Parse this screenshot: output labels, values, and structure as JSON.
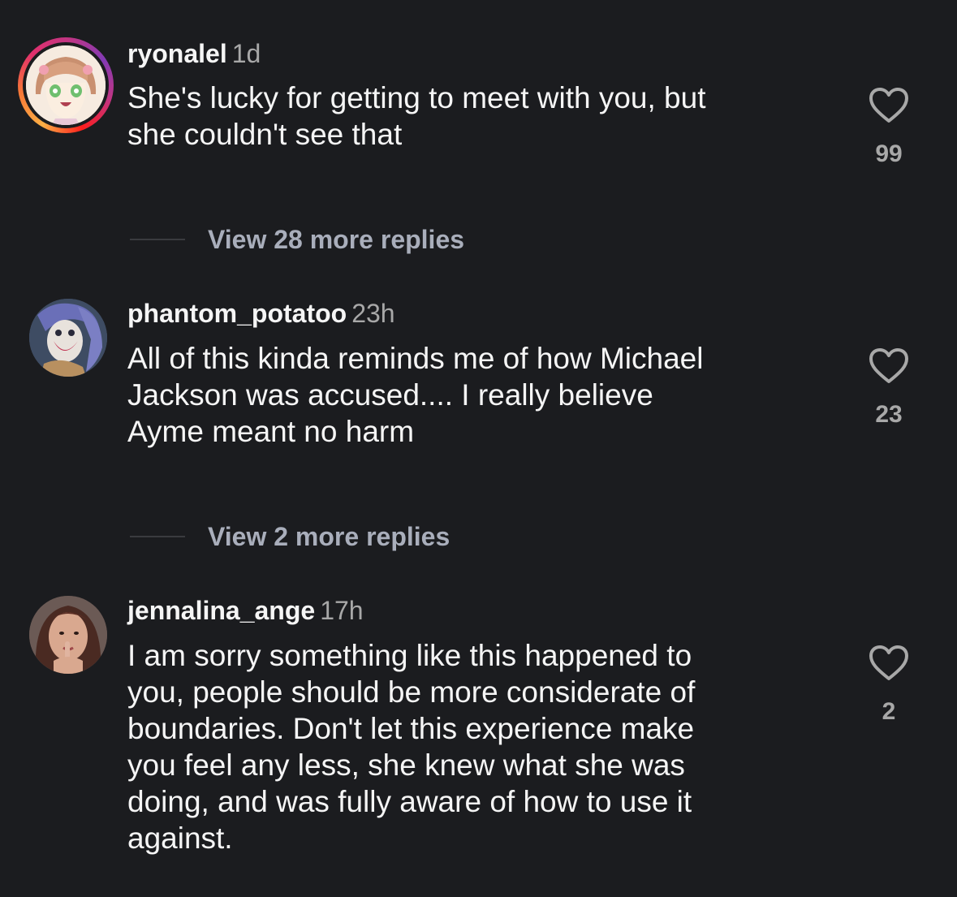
{
  "comments": [
    {
      "username": "ryonalel",
      "time": "1d",
      "text_lines": [
        "She's lucky for getting to meet with you, but",
        "she couldn't see that"
      ],
      "likes": "99",
      "has_story_ring": true,
      "avatar": "anime-girl-avatar"
    },
    {
      "username": "phantom_potatoo",
      "time": "23h",
      "text_lines": [
        "All of this kinda reminds me of how Michael",
        "Jackson was accused.... I really believe",
        "Ayme meant no harm"
      ],
      "likes": "23",
      "has_story_ring": false,
      "avatar": "joker-art-avatar"
    },
    {
      "username": "jennalina_ange",
      "time": "17h",
      "text_lines": [
        "I am sorry something like this happened to",
        "you, people should be more considerate of",
        "boundaries. Don't let this experience make",
        "you feel any less, she knew what she was",
        "doing, and was fully aware of how to use it",
        "against."
      ],
      "likes": "2",
      "has_story_ring": false,
      "avatar": "selfie-avatar"
    }
  ],
  "replies": [
    {
      "label": "View 28 more replies"
    },
    {
      "label": "View 2 more replies"
    }
  ],
  "colors": {
    "background": "#1b1c1f",
    "text": "#f5f5f5",
    "secondary": "#a8a8a8",
    "reply_link": "#a9aebb"
  }
}
